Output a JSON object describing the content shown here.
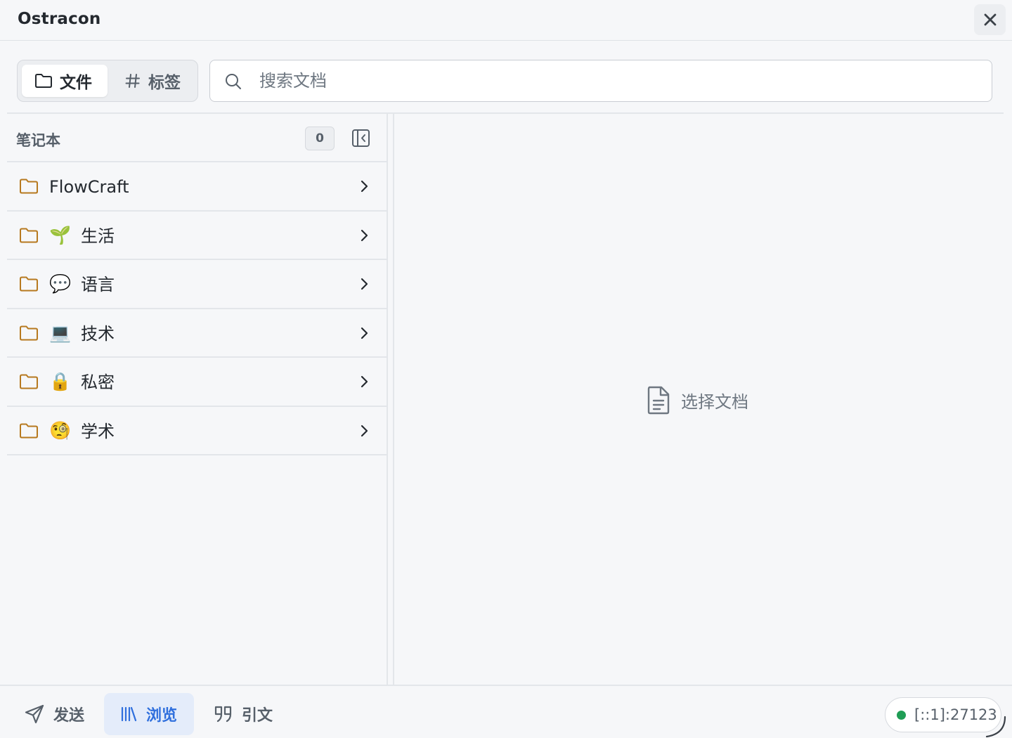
{
  "app": {
    "title": "Ostracon"
  },
  "titlebar": {
    "close_icon": "close-icon"
  },
  "view_toggle": {
    "files_label": "文件",
    "files_icon": "folder-icon",
    "tags_label": "标签",
    "tags_icon": "hash-icon",
    "active": "files"
  },
  "search": {
    "placeholder": "搜索文档",
    "value": ""
  },
  "sidebar": {
    "title": "笔记本",
    "count": "0",
    "collapse_icon": "sidebar-collapse-icon",
    "notebooks": [
      {
        "emoji": "",
        "name": "FlowCraft"
      },
      {
        "emoji": "🌱",
        "name": "生活"
      },
      {
        "emoji": "💬",
        "name": "语言"
      },
      {
        "emoji": "💻",
        "name": "技术"
      },
      {
        "emoji": "🔒",
        "name": "私密"
      },
      {
        "emoji": "🧐",
        "name": "学术"
      }
    ]
  },
  "main": {
    "empty_text": "选择文档",
    "empty_icon": "document-icon"
  },
  "bottom_nav": {
    "send_label": "发送",
    "browse_label": "浏览",
    "cite_label": "引文",
    "active": "browse"
  },
  "status": {
    "address": "[::1]:27123",
    "state": "connected",
    "state_color": "#1f9d55"
  },
  "colors": {
    "accent": "#2f6fdd",
    "accent_bg": "#e4ecfa",
    "folder": "#b7791f"
  }
}
